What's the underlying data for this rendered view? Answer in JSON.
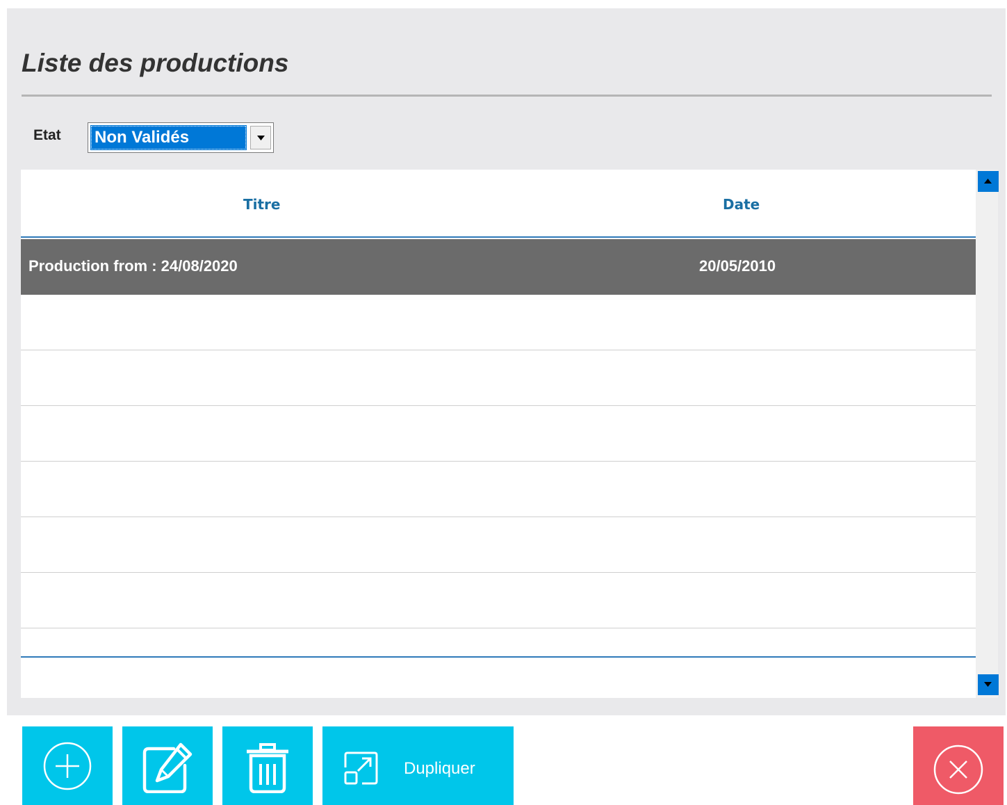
{
  "page": {
    "title": "Liste des productions"
  },
  "filter": {
    "label": "Etat",
    "selected_value": "Non Validés"
  },
  "grid": {
    "columns": [
      "Titre",
      "Date"
    ],
    "rows": [
      {
        "titre": "Production from : 24/08/2020",
        "date": "20/05/2010",
        "selected": true
      }
    ]
  },
  "toolbar": {
    "add_icon": "plus-circle-icon",
    "edit_icon": "edit-pencil-icon",
    "delete_icon": "trash-icon",
    "duplicate_icon": "duplicate-icon",
    "duplicate_label": "Dupliquer",
    "close_icon": "close-circle-icon"
  },
  "colors": {
    "accent": "#00c6ea",
    "danger": "#ef5a67",
    "selection": "#0078d7",
    "selected_row": "#6b6b6b",
    "header_text": "#1a6fa3"
  }
}
